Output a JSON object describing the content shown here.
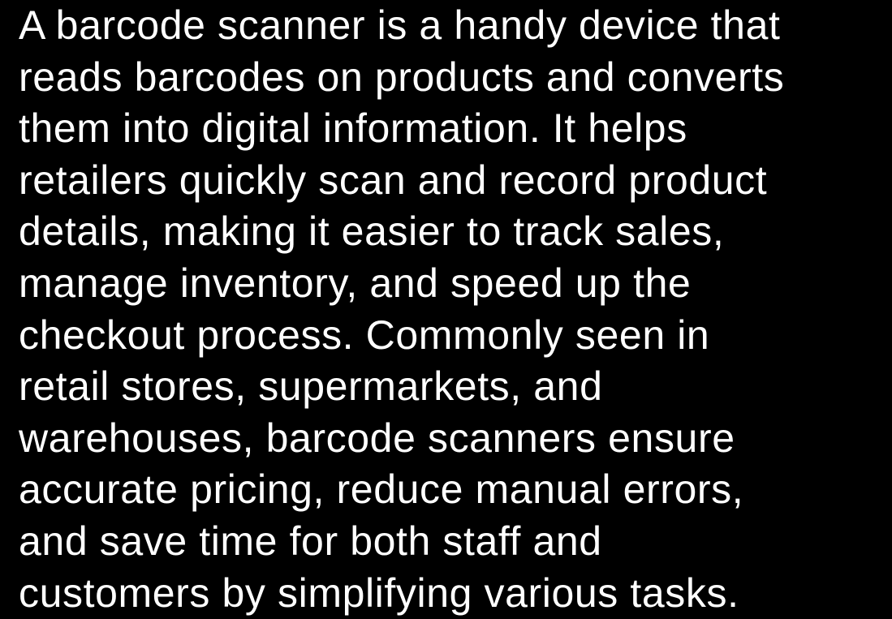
{
  "document": {
    "background_color": "#000000",
    "text_color": "#ffffff",
    "lines": [
      "A barcode scanner is a handy device that",
      "reads barcodes on products and converts",
      "them into digital information. It helps",
      "retailers quickly scan and record product",
      "details, making it easier to track sales,",
      "manage inventory, and speed up the",
      "checkout process. Commonly seen in",
      "retail stores, supermarkets, and",
      "warehouses, barcode scanners ensure",
      "accurate pricing, reduce manual errors,",
      "and save time for both staff and",
      "customers by simplifying various tasks."
    ]
  }
}
